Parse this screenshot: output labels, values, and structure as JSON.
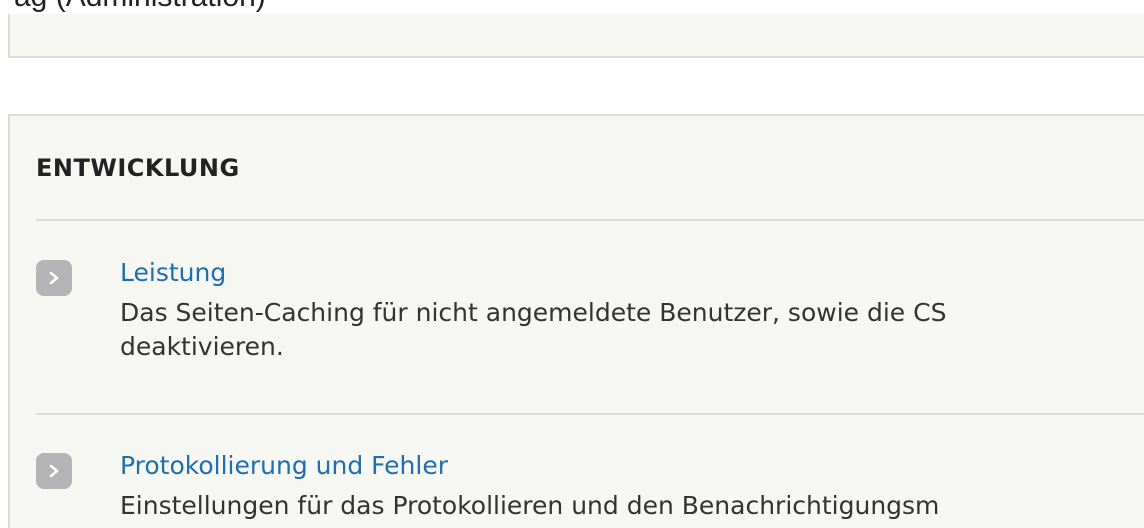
{
  "top_caption": "ag (Administration)",
  "section": {
    "title": "ENTWICKLUNG",
    "items": [
      {
        "label": "Leistung",
        "description_line1": "Das Seiten-Caching für nicht angemeldete Benutzer, sowie die CS",
        "description_line2": "deaktivieren.",
        "icon": "chevron-right-icon"
      },
      {
        "label": "Protokollierung und Fehler",
        "description_line1": "Einstellungen für das Protokollieren und den Benachrichtigungsm",
        "icon": "chevron-right-icon"
      }
    ]
  },
  "colors": {
    "link": "#1f6fae",
    "panel_bg": "#f6f6f2",
    "border": "#dcdcd6",
    "arrow_bg": "#b4b4b4"
  }
}
